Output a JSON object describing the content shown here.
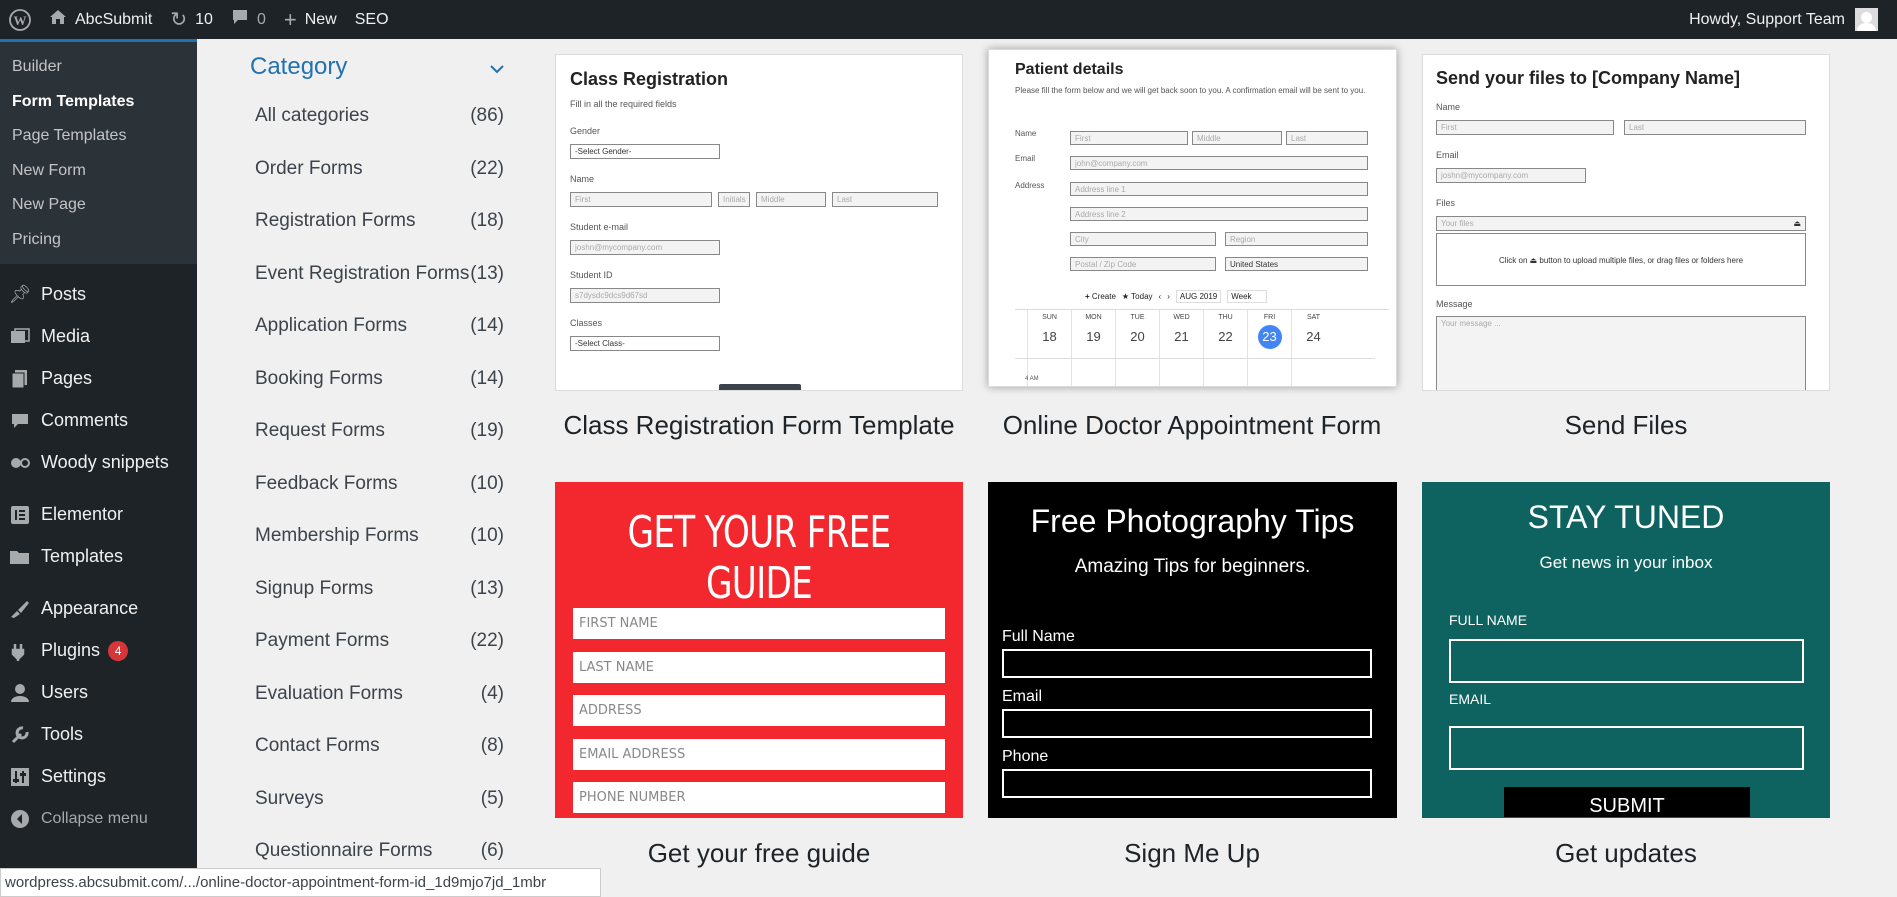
{
  "adminbar": {
    "site_name": "AbcSubmit",
    "updates_count": "10",
    "comments_count": "0",
    "new_label": "New",
    "seo_label": "SEO",
    "howdy": "Howdy, Support Team"
  },
  "sidebar": {
    "submenu": [
      "Builder",
      "Form Templates",
      "Page Templates",
      "New Form",
      "New Page",
      "Pricing"
    ],
    "current_submenu": "Form Templates",
    "menu": [
      {
        "label": "Posts",
        "icon": "pin-icon"
      },
      {
        "label": "Media",
        "icon": "media-icon"
      },
      {
        "label": "Pages",
        "icon": "pages-icon"
      },
      {
        "label": "Comments",
        "icon": "comment-icon"
      },
      {
        "label": "Woody snippets",
        "icon": "snippet-icon"
      },
      {
        "label": "Elementor",
        "icon": "elementor-icon"
      },
      {
        "label": "Templates",
        "icon": "folder-icon"
      },
      {
        "label": "Appearance",
        "icon": "brush-icon"
      },
      {
        "label": "Plugins",
        "icon": "plug-icon",
        "badge": "4"
      },
      {
        "label": "Users",
        "icon": "user-icon"
      },
      {
        "label": "Tools",
        "icon": "wrench-icon"
      },
      {
        "label": "Settings",
        "icon": "settings-icon"
      }
    ],
    "collapse_label": "Collapse menu"
  },
  "category": {
    "heading": "Category",
    "items": [
      {
        "name": "All categories",
        "count": "(86)"
      },
      {
        "name": "Order Forms",
        "count": "(22)"
      },
      {
        "name": "Registration Forms",
        "count": "(18)"
      },
      {
        "name": "Event Registration Forms",
        "count": "(13)"
      },
      {
        "name": "Application Forms",
        "count": "(14)"
      },
      {
        "name": "Booking Forms",
        "count": "(14)"
      },
      {
        "name": "Request Forms",
        "count": "(19)"
      },
      {
        "name": "Feedback Forms",
        "count": "(10)"
      },
      {
        "name": "Membership Forms",
        "count": "(10)"
      },
      {
        "name": "Signup Forms",
        "count": "(13)"
      },
      {
        "name": "Payment Forms",
        "count": "(22)"
      },
      {
        "name": "Evaluation Forms",
        "count": "(4)"
      },
      {
        "name": "Contact Forms",
        "count": "(8)"
      },
      {
        "name": "Surveys",
        "count": "(5)"
      },
      {
        "name": "Questionnaire Forms",
        "count": "(6)"
      }
    ]
  },
  "templates": [
    {
      "title": "Class Registration Form Template"
    },
    {
      "title": "Online Doctor Appointment Form"
    },
    {
      "title": "Send Files"
    },
    {
      "title": "Get your free guide"
    },
    {
      "title": "Sign Me Up"
    },
    {
      "title": "Get updates"
    }
  ],
  "preview_class": {
    "heading": "Class Registration",
    "sub": "Fill in all the required fields",
    "gender": "Gender",
    "gender_select": "-Select Gender-",
    "name": "Name",
    "first": "First",
    "initials": "Initials",
    "middle": "Middle",
    "last": "Last",
    "email_label": "Student e-mail",
    "email_ph": "joshn@mycompany.com",
    "id_label": "Student ID",
    "id_val": "s7dysdc9dcs9d67sd",
    "classes_label": "Classes",
    "classes_select": "-Select Class-"
  },
  "preview_doctor": {
    "heading": "Patient details",
    "sub": "Please fill the form below and we will get back soon to you. A confirmation email will be sent to you.",
    "name": "Name",
    "email": "Email",
    "address": "Address",
    "first": "First",
    "middle": "Middle",
    "last": "Last",
    "email_ph": "john@company.com",
    "addr1": "Address line 1",
    "addr2": "Address line 2",
    "city": "City",
    "region": "Region",
    "postal": "Postal / Zip Code",
    "country": "United States",
    "create": "Create",
    "today": "Today",
    "month": "AUG",
    "year": "2019",
    "view": "Week",
    "days": [
      "SUN",
      "MON",
      "TUE",
      "WED",
      "THU",
      "FRI",
      "SAT"
    ],
    "dates": [
      "18",
      "19",
      "20",
      "21",
      "22",
      "23",
      "24"
    ],
    "time": "4 AM"
  },
  "preview_files": {
    "heading": "Send your files to [Company Name]",
    "name": "Name",
    "first": "First",
    "last": "Last",
    "email": "Email",
    "email_ph": "joshn@mycompany.com",
    "files": "Files",
    "your_files": "Your files",
    "drop_text": "Click on ⏏ button to upload multiple files, or drag files or folders here",
    "message": "Message",
    "message_ph": "Your message ..."
  },
  "preview_guide": {
    "heading": "GET YOUR FREE GUIDE",
    "fields": [
      "FIRST NAME",
      "LAST NAME",
      "ADDRESS",
      "EMAIL ADDRESS",
      "PHONE NUMBER"
    ]
  },
  "preview_photo": {
    "heading": "Free Photography Tips",
    "sub": "Amazing Tips for beginners.",
    "fields": [
      "Full Name",
      "Email",
      "Phone"
    ]
  },
  "preview_updates": {
    "heading": "STAY TUNED",
    "sub": "Get news in your inbox",
    "fields": [
      "FULL NAME",
      "EMAIL"
    ],
    "button": "SUBMIT"
  },
  "status_url": "wordpress.abcsubmit.com/.../online-doctor-appointment-form-id_1d9mjo7jd_1mbr",
  "colors": {
    "admin_dark": "#1d2327",
    "accent": "#2271b1",
    "guide_red": "#f2282e",
    "updates_teal": "#0e6260"
  }
}
